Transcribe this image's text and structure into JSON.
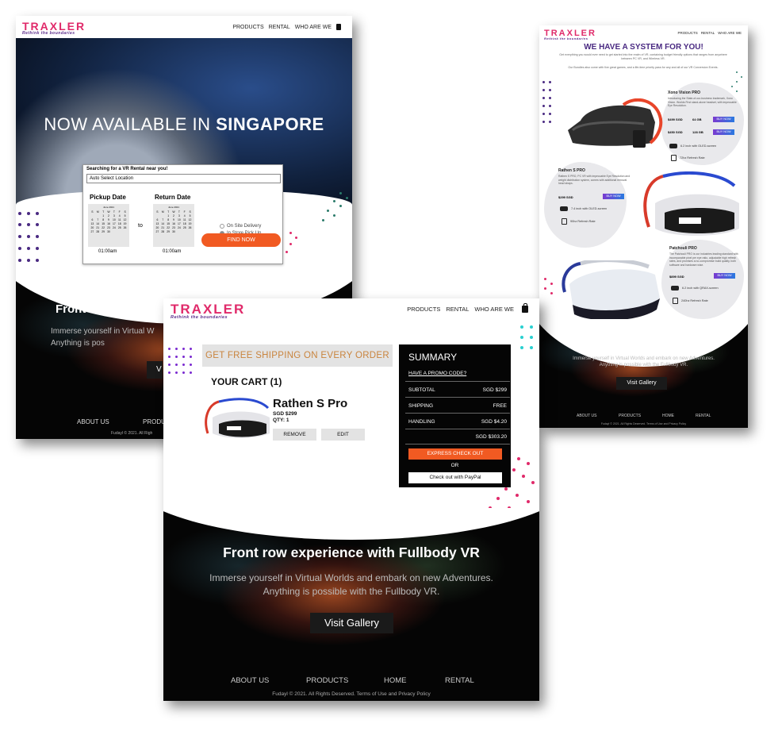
{
  "colors": {
    "brand_pink": "#e02a6a",
    "brand_purple": "#4a2a82",
    "accent_orange": "#f15a22",
    "shipping_text": "#c9843e",
    "summary_bg": "#050505",
    "buy_gradient_start": "#7a3ad0",
    "buy_gradient_end": "#2a7ae0"
  },
  "home": {
    "logo": "TRAXLER",
    "logo_tagline": "Rethink the boundaries",
    "nav": [
      "PRODUCTS",
      "RENTAL",
      "WHO ARE WE"
    ],
    "hero_title_prefix": "NOW AVAILABLE IN ",
    "hero_title_strong": "SINGAPORE",
    "booking": {
      "question": "Searching for a VR Rental near you!",
      "location_value": "Auto Select Location",
      "pickup_label": "Pickup Date",
      "return_label": "Return Date",
      "to_label": "to",
      "calendar_month": "June 2021",
      "weekdays": [
        "S",
        "M",
        "T",
        "W",
        "T",
        "F",
        "S"
      ],
      "days": [
        "",
        "",
        "1",
        "2",
        "3",
        "4",
        "5",
        "6",
        "7",
        "8",
        "9",
        "10",
        "11",
        "12",
        "13",
        "14",
        "15",
        "16",
        "17",
        "18",
        "19",
        "20",
        "21",
        "22",
        "23",
        "24",
        "25",
        "26",
        "27",
        "28",
        "29",
        "30",
        "",
        "",
        ""
      ],
      "pickup_time": "01:00am",
      "return_time": "01:00am",
      "option_onsite": "On Site Delivery",
      "option_store": "In Store Pick Up",
      "find_button": "FIND NOW"
    },
    "gallery_title": "Front row experie",
    "gallery_subtitle": "Immerse yourself in Virtual W Anything is pos",
    "gallery_button": "V",
    "footer_about": "ABOUT US",
    "footer_products": "PRODU",
    "copyright": "Fudayl © 2021. All Righ"
  },
  "products": {
    "logo": "TRAXLER",
    "logo_tagline": "Rethink the boundaries",
    "nav": [
      "PRODUCTS",
      "RENTAL",
      "WHO ARE WE"
    ],
    "heading": "WE HAVE A SYSTEM FOR YOU!",
    "intro_1": "Get everything you would ever need to get started into the realm of VR, containing budget friendly options that ranges from anywhere between PC VR, and Wireless VR.",
    "intro_2": "Our Bundles also come with five great games, and a life-time priority pass for any and all of our VR Conversion Events.",
    "items": [
      {
        "name": "Xono Vision PRO",
        "desc": "Introducing the State-of-our-business trademark, Xono Vision. Worlds First stand-alone headset, with impeccable Eye Resolution.",
        "prices": [
          {
            "price": "$499",
            "currency": "SGD",
            "storage": "64 GB",
            "button": "BUY NOW"
          },
          {
            "price": "$450",
            "currency": "SGD",
            "storage": "128 GB",
            "button": "BUY NOW"
          }
        ],
        "feature_screen": "6.2 inch with OLED-screen",
        "feature_refresh": "72hz Refresh Rate"
      },
      {
        "name": "Rathen S PRO",
        "desc": "Rathen S PRO, PC VR with impeccable Eye Resolution and weight distribution system, comes with additional removal head straps.",
        "price": "$299",
        "currency": "SGD",
        "button": "BUY NOW",
        "feature_screen": "7.4 inch with OLED-screen",
        "feature_refresh": "90hz Refresh Rate"
      },
      {
        "name": "Patchouli PRO",
        "desc": "The Patchouli PRO is our industries leading standard with incomparable pixel per eye ratio, adjustable high refresh rates, and promises a no-compromise build quality, both software and hardware wise.",
        "price": "$899",
        "currency": "SGD",
        "button": "BUY NOW",
        "feature_screen": "6.2 inch with QRAX-screen",
        "feature_refresh": "240hz Refresh Rate"
      }
    ],
    "gallery_title": "Front row experience with Fullbody VR",
    "gallery_sub_1": "Immerse yourself in Virtual Worlds and embark on new Adventures.",
    "gallery_sub_2": "Anything is possible with the Fullbody VR.",
    "gallery_button": "Visit Gallery",
    "footer": [
      "ABOUT US",
      "PRODUCTS",
      "HOME",
      "RENTAL"
    ],
    "copyright": "Fudayl © 2021. All Rights Deserved. Terms of Use and Privacy Policy"
  },
  "cart": {
    "logo": "TRAXLER",
    "logo_tagline": "Rethink the boundaries",
    "nav": [
      "PRODUCTS",
      "RENTAL",
      "WHO ARE WE"
    ],
    "shipping_banner": "GET FREE SHIPPING ON EVERY ORDER",
    "cart_title": "YOUR CART (1)",
    "item_name": "Rathen S Pro",
    "item_price": "SGD $299",
    "item_qty": "QTY: 1",
    "remove_button": "REMOVE",
    "edit_button": "EDIT",
    "summary": {
      "title": "SUMMARY",
      "promo": "HAVE A PROMO CODE?",
      "subtotal_label": "SUBTOTAL",
      "subtotal_value": "SGD $299",
      "shipping_label": "SHIPPING",
      "shipping_value": "FREE",
      "handling_label": "HANDLING",
      "handling_value": "SGD $4.20",
      "total_value": "SGD $303.20",
      "express_button": "EXPRESS CHECK OUT",
      "or_label": "OR",
      "paypal_button": "Check out with PayPal"
    },
    "gallery_title": "Front row experience with Fullbody VR",
    "gallery_sub_1": "Immerse yourself in Virtual Worlds and embark on new Adventures.",
    "gallery_sub_2": "Anything is possible with the Fullbody VR.",
    "gallery_button": "Visit Gallery",
    "footer": [
      "ABOUT US",
      "PRODUCTS",
      "HOME",
      "RENTAL"
    ],
    "copyright": "Fudayl © 2021. All Rights Deserved. Terms of Use and Privacy Policy"
  }
}
